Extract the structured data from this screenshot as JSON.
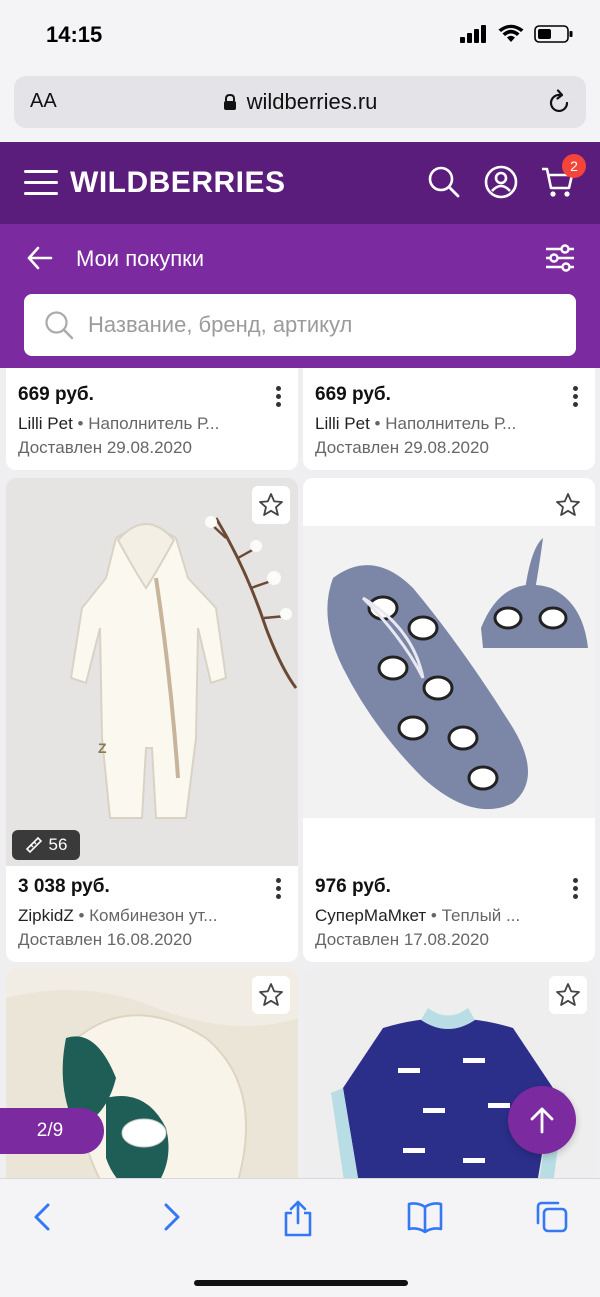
{
  "status": {
    "time": "14:15"
  },
  "browser": {
    "text_size_label": "AA",
    "url": "wildberries.ru"
  },
  "header": {
    "logo": "WILDBERRIES",
    "cart_count": "2"
  },
  "subheader": {
    "title": "Мои покупки",
    "search_placeholder": "Название, бренд, артикул"
  },
  "products": [
    {
      "price": "669 руб.",
      "brand": "Lilli Pet",
      "category": "Наполнитель Р...",
      "status": "Доставлен 29.08.2020"
    },
    {
      "price": "669 руб.",
      "brand": "Lilli Pet",
      "category": "Наполнитель Р...",
      "status": "Доставлен 29.08.2020"
    },
    {
      "price": "3 038 руб.",
      "brand": "ZipkidZ",
      "category": "Комбинезон ут...",
      "status": "Доставлен 16.08.2020",
      "size": "56"
    },
    {
      "price": "976 руб.",
      "brand": "СуперМаМкет",
      "category": "Теплый ...",
      "status": "Доставлен 17.08.2020"
    }
  ],
  "pagination": {
    "label": "2/9"
  },
  "colors": {
    "brand_dark": "#5b1d7c",
    "brand": "#7b2aa0",
    "badge": "#f5453a"
  }
}
